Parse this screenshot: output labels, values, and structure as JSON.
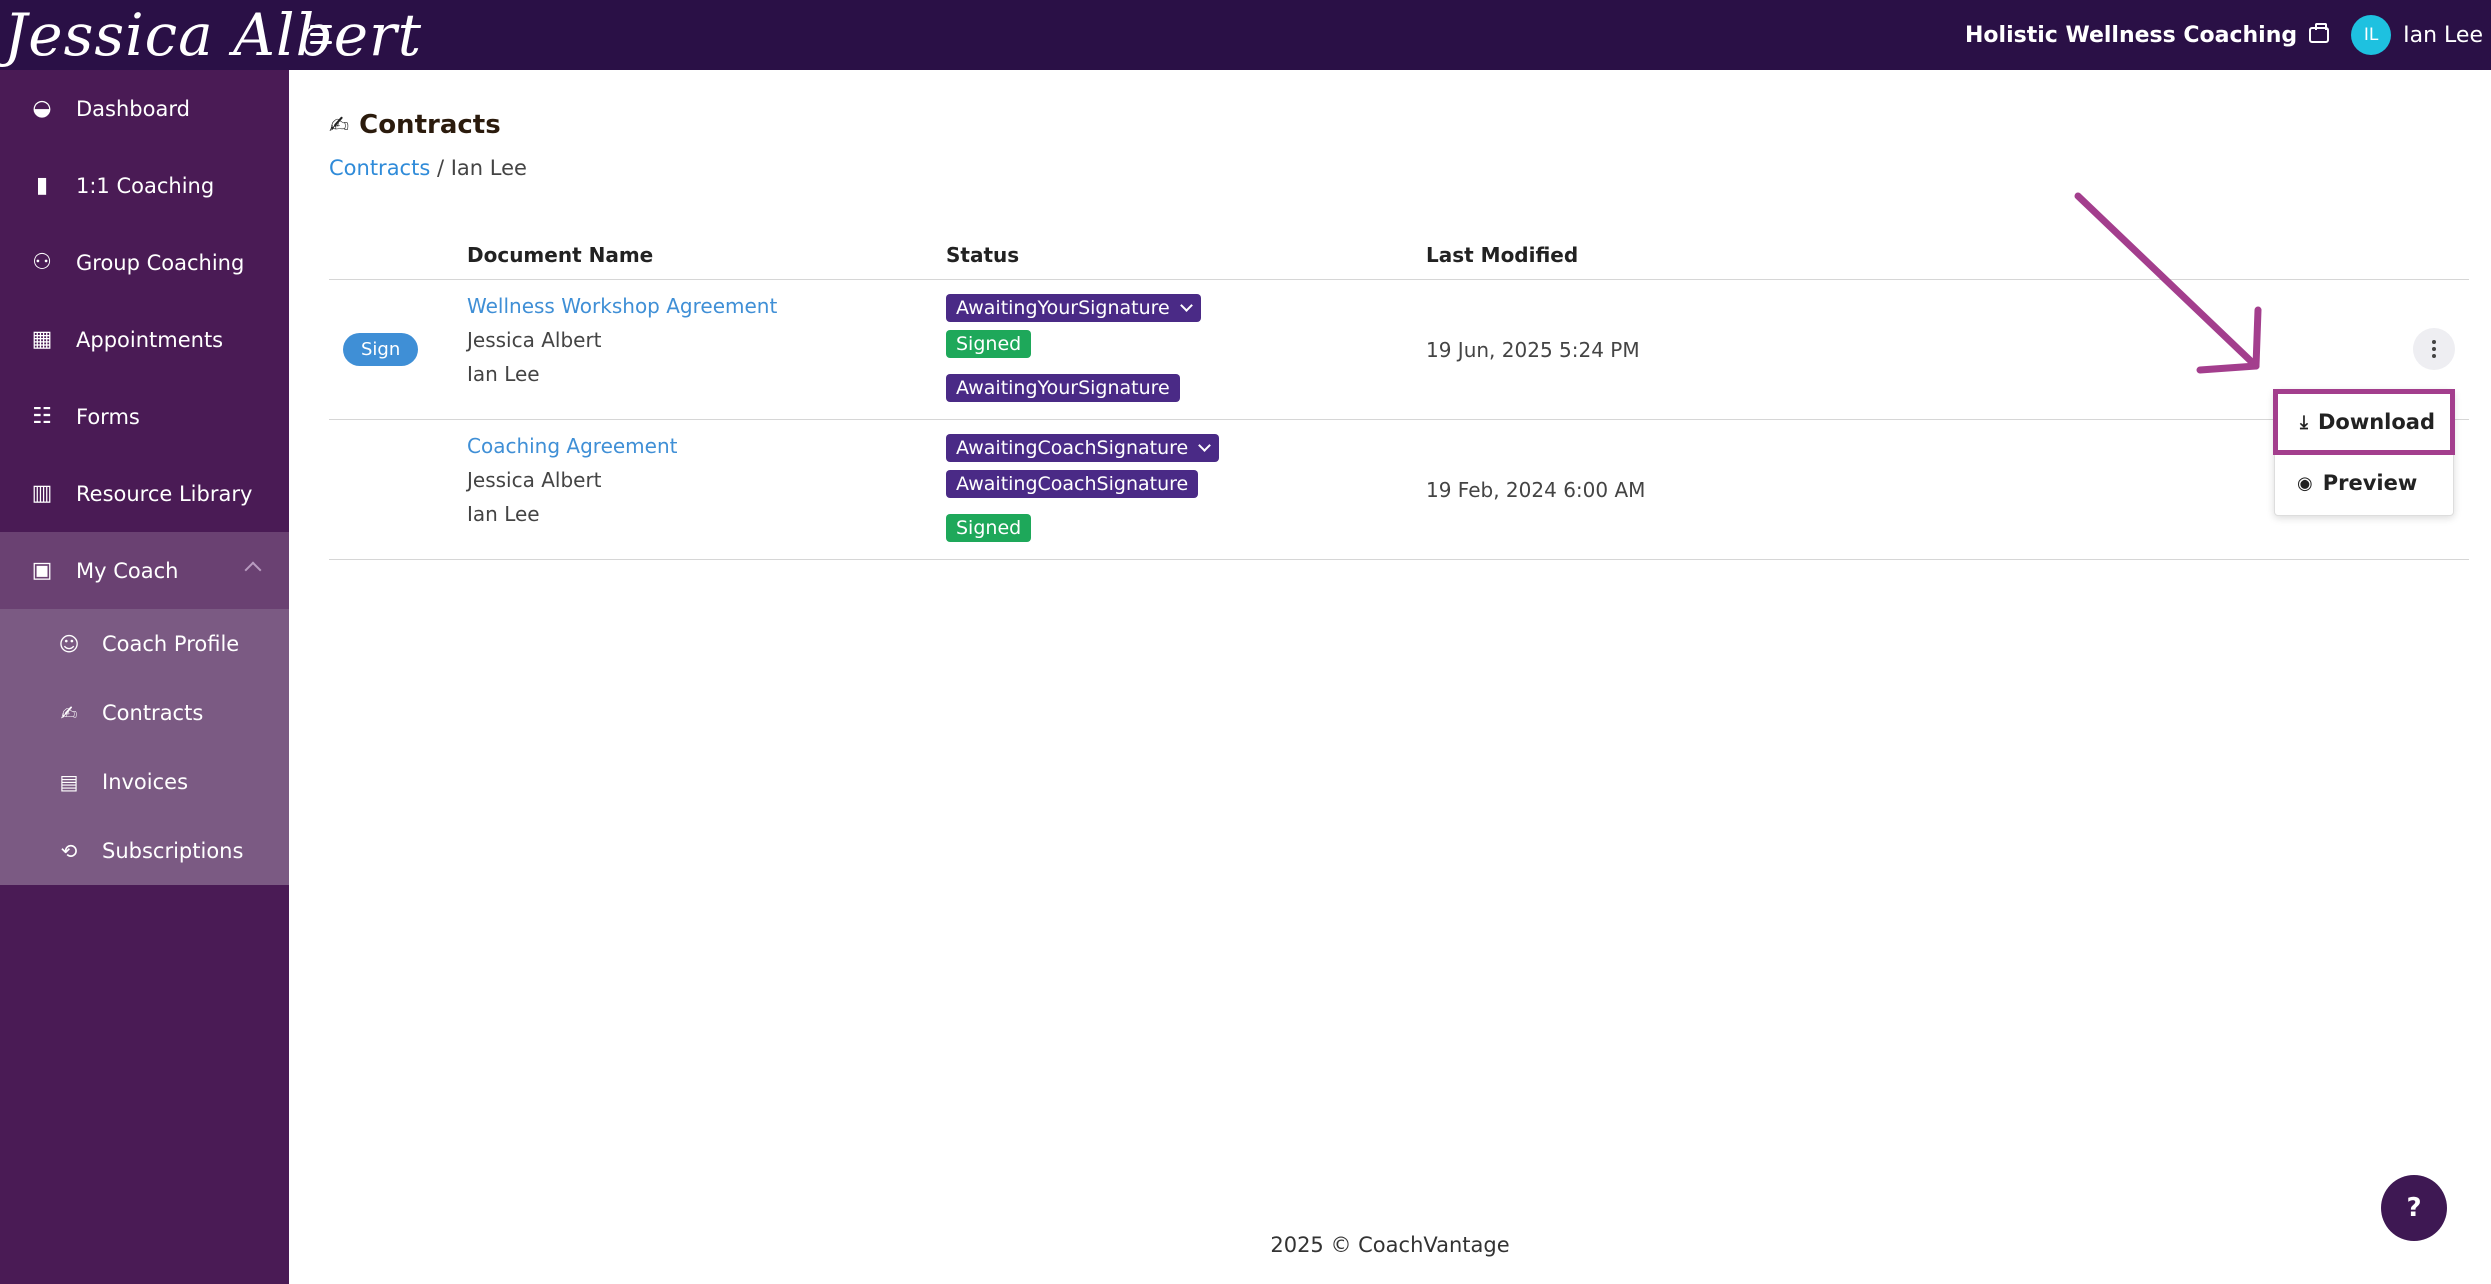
{
  "brand": {
    "logo_text": "Jessica Albert"
  },
  "header": {
    "org_name": "Holistic Wellness Coaching",
    "user_initials": "IL",
    "user_name": "Ian Lee"
  },
  "sidebar": {
    "items": [
      {
        "label": "Dashboard",
        "icon": "dashboard-icon"
      },
      {
        "label": "1:1 Coaching",
        "icon": "book-icon"
      },
      {
        "label": "Group Coaching",
        "icon": "users-icon"
      },
      {
        "label": "Appointments",
        "icon": "calendar-icon"
      },
      {
        "label": "Forms",
        "icon": "checklist-icon"
      },
      {
        "label": "Resource Library",
        "icon": "library-icon"
      }
    ],
    "my_coach": {
      "label": "My Coach",
      "children": [
        {
          "label": "Coach Profile"
        },
        {
          "label": "Contracts"
        },
        {
          "label": "Invoices"
        },
        {
          "label": "Subscriptions"
        }
      ]
    }
  },
  "page": {
    "title": "Contracts",
    "breadcrumb_link": "Contracts",
    "breadcrumb_current": "/ Ian Lee"
  },
  "table": {
    "headers": {
      "name": "Document Name",
      "status": "Status",
      "modified": "Last Modified"
    },
    "rows": [
      {
        "sign_label": "Sign",
        "doc_name": "Wellness Workshop Agreement",
        "overall_status": "AwaitingYourSignature",
        "signers": [
          {
            "name": "Jessica Albert",
            "status": "Signed"
          },
          {
            "name": "Ian Lee",
            "status": "AwaitingYourSignature"
          }
        ],
        "modified": "19 Jun, 2025 5:24 PM"
      },
      {
        "doc_name": "Coaching Agreement",
        "overall_status": "AwaitingCoachSignature",
        "signers": [
          {
            "name": "Jessica Albert",
            "status": "AwaitingCoachSignature"
          },
          {
            "name": "Ian Lee",
            "status": "Signed"
          }
        ],
        "modified": "19 Feb, 2024 6:00 AM"
      }
    ]
  },
  "menu": {
    "download": "Download",
    "preview": "Preview"
  },
  "footer": {
    "text": "2025 © CoachVantage"
  },
  "help": {
    "label": "?"
  },
  "colors": {
    "topbar": "#2a1046",
    "sidebar": "#4a1b55",
    "badge_purple": "#4a2a86",
    "badge_green": "#1ea85a",
    "link": "#3f8fd6",
    "annotation": "#a33e8d"
  }
}
